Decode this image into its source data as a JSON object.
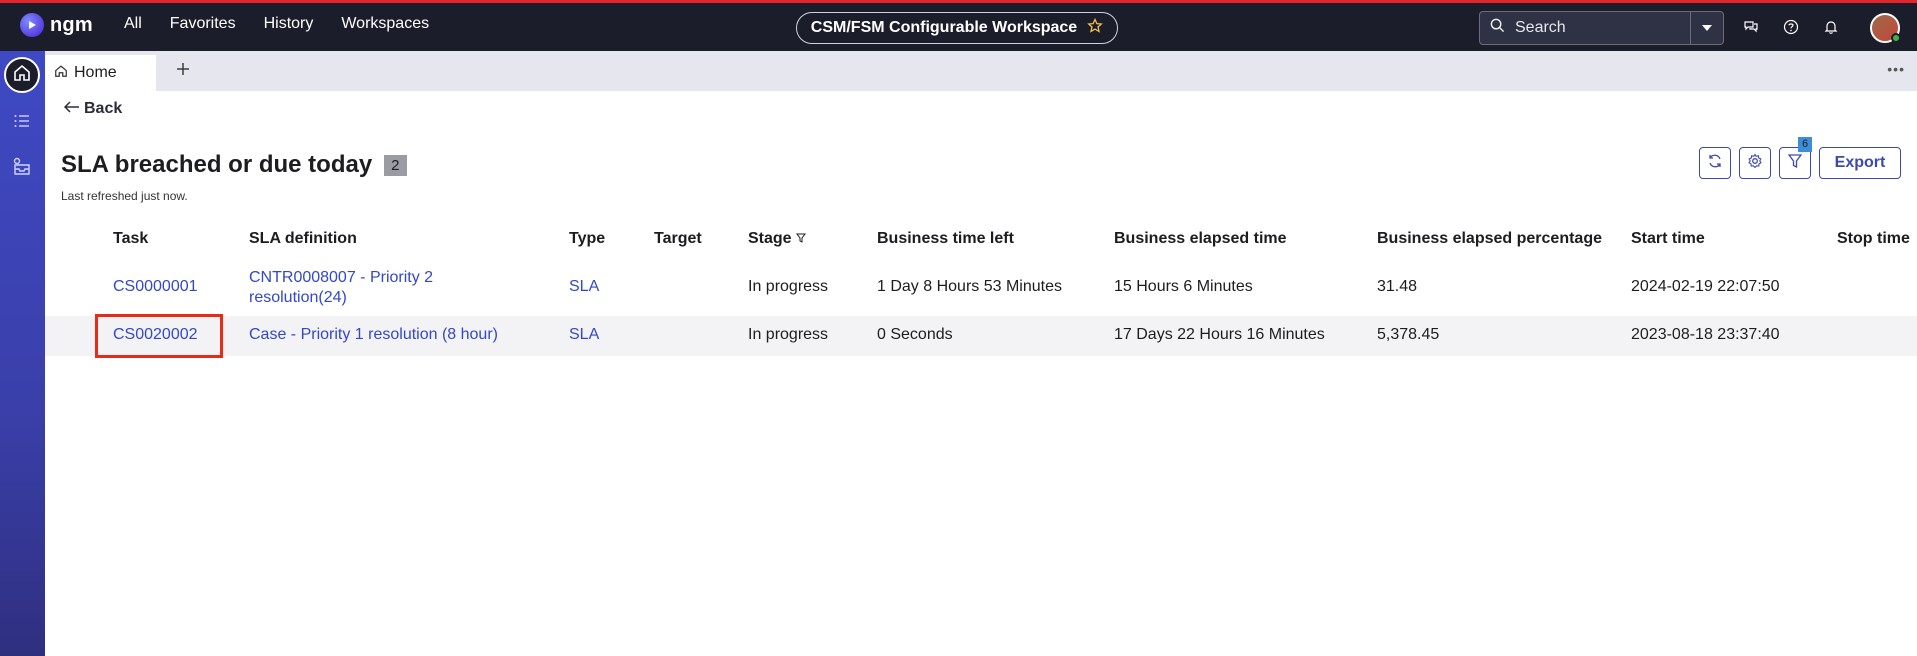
{
  "topbar": {
    "logo_text": "ngm",
    "nav": [
      "All",
      "Favorites",
      "History",
      "Workspaces"
    ],
    "workspace_title": "CSM/FSM Configurable Workspace",
    "search_placeholder": "Search",
    "accent_color": "#e3242b"
  },
  "tabs": {
    "home_label": "Home"
  },
  "page": {
    "back_label": "Back",
    "title": "SLA breached or due today",
    "count": "2",
    "refresh_note": "Last refreshed just now.",
    "filter_count": "6",
    "export_label": "Export"
  },
  "table": {
    "headers": [
      "Task",
      "SLA definition",
      "Type",
      "Target",
      "Stage",
      "Business time left",
      "Business elapsed time",
      "Business elapsed percentage",
      "Start time",
      "Stop time"
    ],
    "rows": [
      {
        "task": "CS0000001",
        "sla_definition_line1": "CNTR0008007 - Priority 2",
        "sla_definition_line2": "resolution(24)",
        "type": "SLA",
        "target": "",
        "stage": "In progress",
        "business_time_left": "1 Day 8 Hours 53 Minutes",
        "business_elapsed_time": "15 Hours 6 Minutes",
        "business_elapsed_percentage": "31.48",
        "start_time": "2024-02-19 22:07:50",
        "stop_time": ""
      },
      {
        "task": "CS0020002",
        "sla_definition_line1": "Case - Priority 1 resolution (8 hour)",
        "type": "SLA",
        "target": "",
        "stage": "In progress",
        "business_time_left": "0 Seconds",
        "business_elapsed_time": "17 Days 22 Hours 16 Minutes",
        "business_elapsed_percentage": "5,378.45",
        "start_time": "2023-08-18 23:37:40",
        "stop_time": ""
      }
    ]
  }
}
